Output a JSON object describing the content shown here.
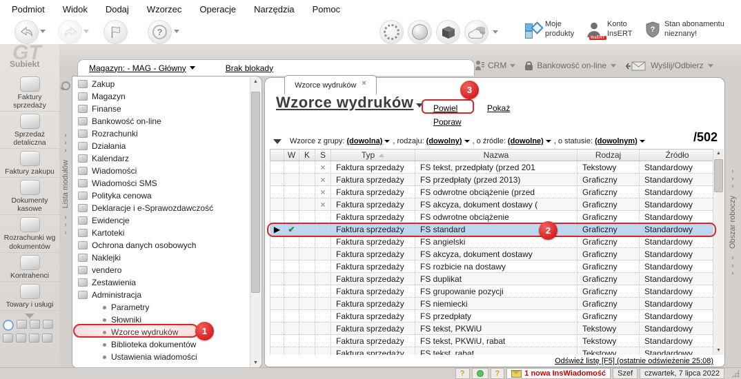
{
  "menu": {
    "items": [
      "Podmiot",
      "Widok",
      "Dodaj",
      "Wzorzec",
      "Operacje",
      "Narzędzia",
      "Pomoc"
    ]
  },
  "toolbar": {
    "moje_produkty": "Moje\nprodukty",
    "konto_insert": "Konto\nInsERT",
    "insert_badge": "InsERT",
    "stan_abonamentu": "Stan abonamentu\nnieznany!"
  },
  "infobar": {
    "magazyn_link": "Magazyn: - MAG - Główny",
    "brak_blokady": "Brak blokady",
    "crm": "CRM",
    "bankowosc": "Bankowość on-line",
    "wyslij_odbierz": "Wyślij/Odbierz"
  },
  "sidebar": {
    "logo_watermark": "GT",
    "logo_text": "Subiekt",
    "items": [
      {
        "label": "Faktury sprzedaży",
        "icon": "sales-invoices-icon"
      },
      {
        "label": "Sprzedaż detaliczna",
        "icon": "retail-sales-icon"
      },
      {
        "label": "Faktury zakupu",
        "icon": "purchase-invoices-icon"
      },
      {
        "label": "Dokumenty kasowe",
        "icon": "cash-documents-icon"
      },
      {
        "label": "Rozrachunki wg dokumentów",
        "icon": "settlements-by-documents-icon"
      },
      {
        "label": "Kontrahenci",
        "icon": "contractors-icon"
      },
      {
        "label": "Towary i usługi",
        "icon": "goods-services-icon"
      }
    ]
  },
  "module_panel": {
    "strip_label": "Lista modułów",
    "items": [
      {
        "label": "Zakup",
        "type": "module",
        "icon": "purchase-icon"
      },
      {
        "label": "Magazyn",
        "type": "module",
        "icon": "warehouse-icon"
      },
      {
        "label": "Finanse",
        "type": "module",
        "icon": "finance-icon"
      },
      {
        "label": "Bankowość on-line",
        "type": "module",
        "icon": "online-banking-icon"
      },
      {
        "label": "Rozrachunki",
        "type": "module",
        "icon": "settlements-icon"
      },
      {
        "label": "Działania",
        "type": "module",
        "icon": "actions-icon"
      },
      {
        "label": "Kalendarz",
        "type": "module",
        "icon": "calendar-icon"
      },
      {
        "label": "Wiadomości",
        "type": "module",
        "icon": "messages-icon"
      },
      {
        "label": "Wiadomości SMS",
        "type": "module",
        "icon": "sms-icon"
      },
      {
        "label": "Polityka cenowa",
        "type": "module",
        "icon": "pricing-policy-icon"
      },
      {
        "label": "Deklaracje i e-Sprawozdawczość",
        "type": "module",
        "icon": "declarations-icon"
      },
      {
        "label": "Ewidencje",
        "type": "module",
        "icon": "records-icon"
      },
      {
        "label": "Kartoteki",
        "type": "module",
        "icon": "card-files-icon"
      },
      {
        "label": "Ochrona danych osobowych",
        "type": "module",
        "icon": "gdpr-icon"
      },
      {
        "label": "Naklejki",
        "type": "module",
        "icon": "labels-icon"
      },
      {
        "label": "vendero",
        "type": "module",
        "icon": "vendero-icon"
      },
      {
        "label": "Zestawienia",
        "type": "module",
        "icon": "reports-icon"
      },
      {
        "label": "Administracja",
        "type": "module",
        "icon": "administration-icon"
      },
      {
        "label": "Parametry",
        "type": "sub"
      },
      {
        "label": "Słowniki",
        "type": "sub"
      },
      {
        "label": "Wzorce wydruków",
        "type": "sub",
        "highlighted": true
      },
      {
        "label": "Biblioteka dokumentów",
        "type": "sub"
      },
      {
        "label": "Ustawienia wiadomości",
        "type": "sub"
      }
    ]
  },
  "content": {
    "tab_label": "Wzorce wydruków",
    "title": "Wzorce wydruków",
    "actions": {
      "powiel": "Powiel",
      "popraw": "Popraw",
      "pokaz": "Pokaż"
    },
    "filter": {
      "parts": [
        {
          "label": "Wzorce z grupy:",
          "value": "(dowolna)"
        },
        {
          "label": ", rodzaju:",
          "value": "(dowolny)"
        },
        {
          "label": ", o źródle:",
          "value": "(dowolne)"
        },
        {
          "label": ", o statusie:",
          "value": "(dowolnym)"
        }
      ],
      "count": "/502"
    },
    "table": {
      "columns": [
        "",
        "W",
        "K",
        "S",
        "Typ",
        "Nazwa",
        "Rodzaj",
        "Źródło"
      ],
      "rows": [
        {
          "s": true,
          "typ": "Faktura sprzedaży",
          "nazwa": "FS tekst, przedpłaty (przed 201",
          "rodzaj": "Tekstowy",
          "zrodlo": "Standardowy"
        },
        {
          "s": true,
          "typ": "Faktura sprzedaży",
          "nazwa": "FS przedpłaty (przed 2013)",
          "rodzaj": "Graficzny",
          "zrodlo": "Standardowy"
        },
        {
          "s": true,
          "typ": "Faktura sprzedaży",
          "nazwa": "FS odwrotne obciążenie (przed",
          "rodzaj": "Graficzny",
          "zrodlo": "Standardowy"
        },
        {
          "s": true,
          "typ": "Faktura sprzedaży",
          "nazwa": "FS akcyza, dokument dostawy (",
          "rodzaj": "Graficzny",
          "zrodlo": "Standardowy"
        },
        {
          "typ": "Faktura sprzedaży",
          "nazwa": "FS odwrotne obciążenie",
          "rodzaj": "Graficzny",
          "zrodlo": "Standardowy"
        },
        {
          "selected": true,
          "w": true,
          "typ": "Faktura sprzedaży",
          "nazwa": "FS standard",
          "rodzaj": "Graficzny",
          "zrodlo": "Standardowy"
        },
        {
          "typ": "Faktura sprzedaży",
          "nazwa": "FS angielski",
          "rodzaj": "Graficzny",
          "zrodlo": "Standardowy"
        },
        {
          "typ": "Faktura sprzedaży",
          "nazwa": "FS akcyza, dokument dostawy",
          "rodzaj": "Graficzny",
          "zrodlo": "Standardowy"
        },
        {
          "typ": "Faktura sprzedaży",
          "nazwa": "FS rozbicie na dostawy",
          "rodzaj": "Graficzny",
          "zrodlo": "Standardowy"
        },
        {
          "typ": "Faktura sprzedaży",
          "nazwa": "FS duplikat",
          "rodzaj": "Graficzny",
          "zrodlo": "Standardowy"
        },
        {
          "typ": "Faktura sprzedaży",
          "nazwa": "FS grupowanie pozycji",
          "rodzaj": "Graficzny",
          "zrodlo": "Standardowy"
        },
        {
          "typ": "Faktura sprzedaży",
          "nazwa": "FS niemiecki",
          "rodzaj": "Graficzny",
          "zrodlo": "Standardowy"
        },
        {
          "typ": "Faktura sprzedaży",
          "nazwa": "FS przedpłaty",
          "rodzaj": "Graficzny",
          "zrodlo": "Standardowy"
        },
        {
          "typ": "Faktura sprzedaży",
          "nazwa": "FS tekst, PKWiU",
          "rodzaj": "Tekstowy",
          "zrodlo": "Standardowy"
        },
        {
          "typ": "Faktura sprzedaży",
          "nazwa": "FS tekst, PKWiU, rabat",
          "rodzaj": "Tekstowy",
          "zrodlo": "Standardowy"
        },
        {
          "typ": "Faktura sprzedaży",
          "nazwa": "FS tekst, rabat",
          "rodzaj": "Tekstowy",
          "zrodlo": "Standardowy"
        }
      ]
    },
    "refresh_link": "Odśwież listę [F5] (ostatnie odświeżenie 25:08)"
  },
  "right_strip": {
    "label": "Obszar roboczy"
  },
  "statusbar": {
    "new_message": "1 nowa InsWiadomość",
    "user": "Szef",
    "date": "czwartek, 7 lipca 2022"
  },
  "callouts": {
    "c1": "1",
    "c2": "2",
    "c3": "3"
  },
  "colors": {
    "accent_red": "#d8262b",
    "selection_blue": "#bdd7f0",
    "alert_text": "#cc0000",
    "product_blue": "#6cb4e4"
  }
}
